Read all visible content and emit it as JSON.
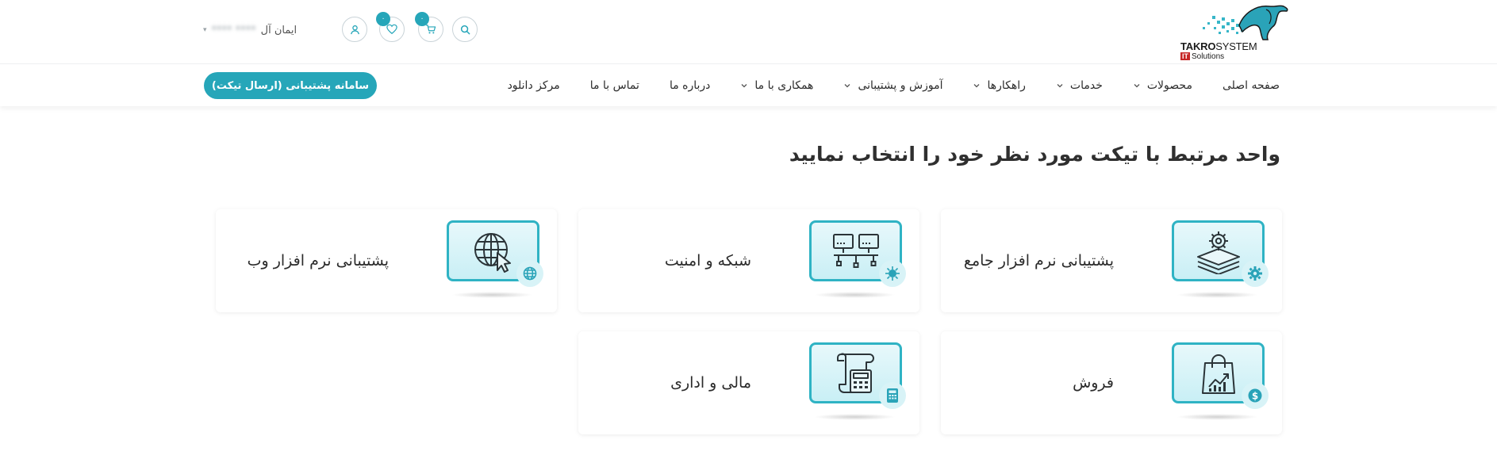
{
  "header": {
    "logo": {
      "brand_bold": "TAKRO",
      "brand_light": "SYSTEM",
      "it_tag": "IT",
      "sub": "Solutions"
    },
    "user": {
      "greeting": "ایمان آل",
      "name_blurred": "**** ****"
    },
    "cart_badge": "۰",
    "wishlist_badge": "۰",
    "icons": {
      "search": "search-icon",
      "cart": "cart-icon",
      "wishlist": "heart-icon",
      "account": "user-icon"
    }
  },
  "nav": {
    "items": [
      {
        "label": "صفحه اصلی",
        "dropdown": false
      },
      {
        "label": "محصولات",
        "dropdown": true
      },
      {
        "label": "خدمات",
        "dropdown": true
      },
      {
        "label": "راهکارها",
        "dropdown": true
      },
      {
        "label": "آموزش و پشتیبانی",
        "dropdown": true
      },
      {
        "label": "همکاری با ما",
        "dropdown": true
      },
      {
        "label": "درباره ما",
        "dropdown": false
      },
      {
        "label": "تماس با ما",
        "dropdown": false
      },
      {
        "label": "مرکز دانلود",
        "dropdown": false
      }
    ],
    "ticket_button": "سامانه پشتیبانی (ارسال تیکت)"
  },
  "main": {
    "heading": "واحد مرتبط با تیکت مورد نظر خود را انتخاب نمایید",
    "cards": [
      {
        "label": "پشتیبانی نرم افزار جامع",
        "icon": "layers-gear-icon",
        "badge_icon": "gear-icon"
      },
      {
        "label": "شبکه و امنیت",
        "icon": "network-computers-icon",
        "badge_icon": "virus-icon"
      },
      {
        "label": "پشتیبانی نرم افزار وب",
        "icon": "globe-cursor-icon",
        "badge_icon": "globe-icon"
      },
      {
        "label": "فروش",
        "icon": "shopping-bag-chart-icon",
        "badge_icon": "dollar-icon"
      },
      {
        "label": "مالی و اداری",
        "icon": "invoice-calculator-icon",
        "badge_icon": "calculator-icon"
      }
    ]
  },
  "colors": {
    "accent": "#26a6b9",
    "tile_border": "#2fb3c4",
    "tile_bg": "#cdeff5",
    "text": "#2b2b2b"
  }
}
